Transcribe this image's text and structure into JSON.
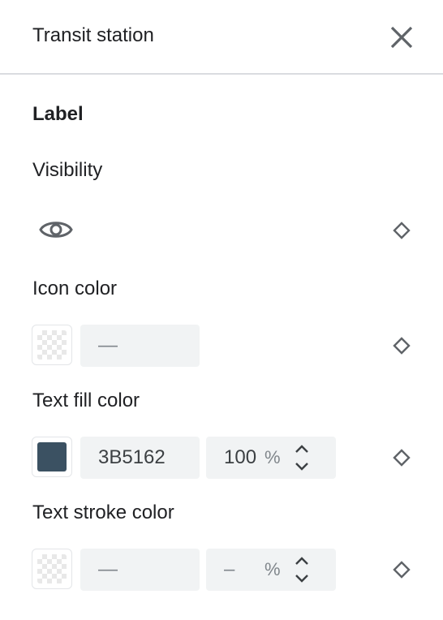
{
  "panel": {
    "title": "Transit station"
  },
  "section": {
    "title": "Label"
  },
  "visibility": {
    "label": "Visibility",
    "icon": "eye-icon"
  },
  "icon_color": {
    "label": "Icon color",
    "hex_value": "—"
  },
  "text_fill_color": {
    "label": "Text fill color",
    "swatch_color": "#3B5162",
    "hex_value": "3B5162",
    "opacity_value": "100",
    "percent_sign": "%"
  },
  "text_stroke_color": {
    "label": "Text stroke color",
    "hex_value": "—",
    "opacity_value": "–",
    "percent_sign": "%"
  },
  "colors": {
    "icon_gray": "#5f6368",
    "divider": "#dadce0",
    "field_bg": "#f1f3f4"
  }
}
